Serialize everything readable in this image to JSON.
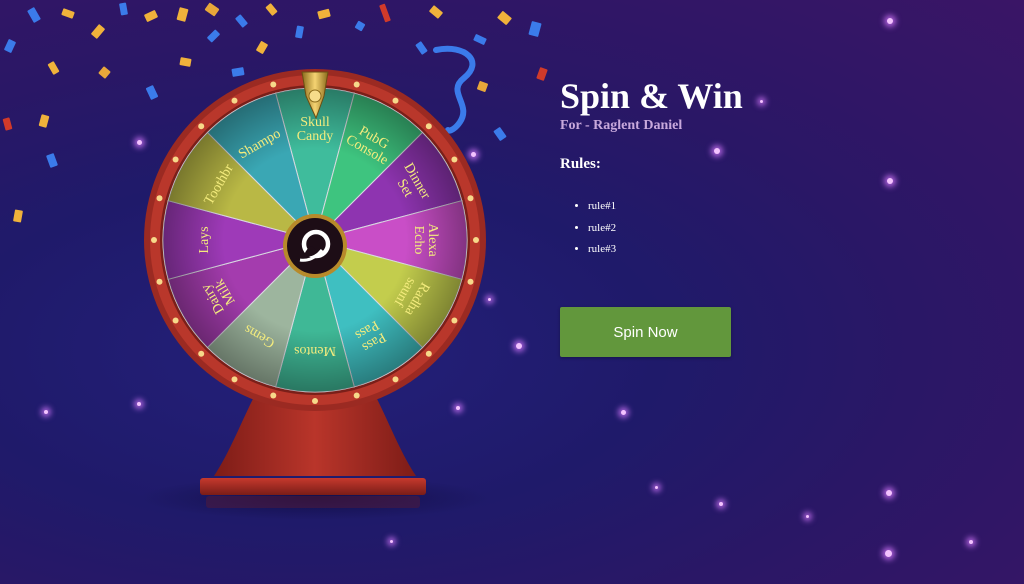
{
  "app": {
    "title": "Spin & Win",
    "subtitle": "For - Raglent Daniel"
  },
  "rules": {
    "heading": "Rules:",
    "items": [
      "rule#1",
      "rule#2",
      "rule#3"
    ]
  },
  "actions": {
    "spin_label": "Spin Now"
  },
  "wheel": {
    "segments": [
      {
        "label": [
          "Skull",
          "Candy"
        ],
        "color": "#3fbc9c"
      },
      {
        "label": [
          "PubG",
          "Console"
        ],
        "color": "#3ec47f"
      },
      {
        "label": [
          "Dinner",
          "Set"
        ],
        "color": "#8e34b0"
      },
      {
        "label": [
          "Alexa",
          "Echo"
        ],
        "color": "#c94ec7"
      },
      {
        "label": [
          "Radha",
          "saunf"
        ],
        "color": "#c3cd4d"
      },
      {
        "label": [
          "Pass",
          "Pass"
        ],
        "color": "#3fbfc1"
      },
      {
        "label": [
          "Mentos"
        ],
        "color": "#3fb896"
      },
      {
        "label": [
          "Gems"
        ],
        "color": "#9db59e"
      },
      {
        "label": [
          "Dairy",
          "Milk"
        ],
        "color": "#a43cae"
      },
      {
        "label": [
          "Lays"
        ],
        "color": "#9e3ab8"
      },
      {
        "label": [
          "Toothbr"
        ],
        "color": "#b9b845"
      },
      {
        "label": [
          "Shampo"
        ],
        "color": "#3aa7b4"
      }
    ],
    "label_color": "#f4ec7d",
    "rim_color": "#b23226",
    "stand_color": "#a22b22"
  },
  "theme": {
    "accent_button": "#62973c",
    "subtitle_color": "#c8a9dc"
  }
}
